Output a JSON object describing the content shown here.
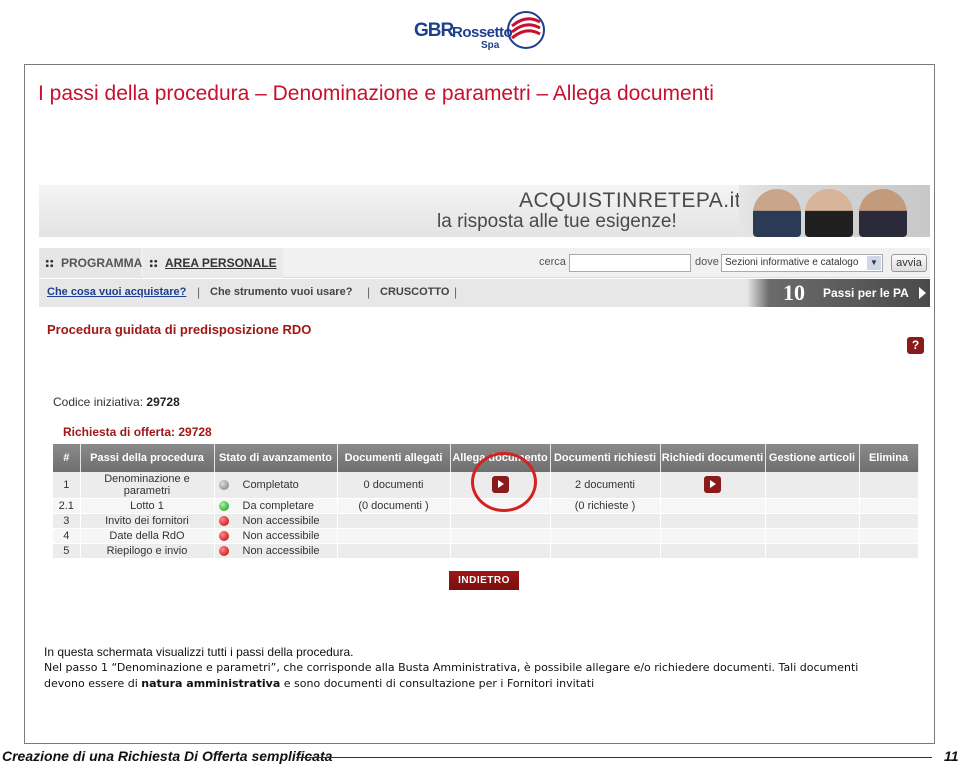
{
  "logo": {
    "gbr": "GBR",
    "rossetto": "Rossetto",
    "spa": "Spa"
  },
  "slide": {
    "title": "I passi della procedura – Denominazione e parametri – Allega documenti"
  },
  "banner": {
    "title": "ACQUISTINRETEPA.it",
    "subtitle": "la risposta alle tue esigenze!"
  },
  "nav": {
    "programma": "PROGRAMMA",
    "area_personale": "AREA PERSONALE",
    "cerca_label": "cerca",
    "cerca_value": "",
    "dove_label": "dove",
    "dove_value": "Sezioni informative e catalogo",
    "avvia": "avvia"
  },
  "subnav": {
    "item1": "Che cosa vuoi acquistare?",
    "sep": "|",
    "item2": "Che strumento vuoi usare?",
    "item3": "CRUSCOTTO",
    "passi_number": "10",
    "passi_label": "Passi per le PA"
  },
  "procedure": {
    "title": "Procedura guidata di predisposizione RDO",
    "help": "?",
    "codice_label": "Codice iniziativa:",
    "codice_value": "29728",
    "richiesta": "Richiesta di offerta: 29728"
  },
  "table": {
    "headers": [
      "#",
      "Passi della procedura",
      "Stato di avanzamento",
      "Documenti allegati",
      "Allega documento",
      "Documenti richiesti",
      "Richiedi documenti",
      "Gestione articoli",
      "Elimina"
    ],
    "rows": [
      {
        "num": "1",
        "passo": "Denominazione e parametri",
        "status_color": "grey",
        "stato": "Completato",
        "allegati": "0 documenti",
        "allega_icon": true,
        "richiesti": "2 documenti",
        "richiedi_icon": true
      },
      {
        "num": "2.1",
        "passo": "Lotto 1",
        "status_color": "green",
        "stato": "Da completare",
        "allegati": "(0 documenti )",
        "allega_icon": false,
        "richiesti": "(0 richieste )",
        "richiedi_icon": false
      },
      {
        "num": "3",
        "passo": "Invito dei fornitori",
        "status_color": "red",
        "stato": "Non accessibile",
        "allegati": "",
        "allega_icon": false,
        "richiesti": "",
        "richiedi_icon": false
      },
      {
        "num": "4",
        "passo": "Date della RdO",
        "status_color": "red",
        "stato": "Non accessibile",
        "allegati": "",
        "allega_icon": false,
        "richiesti": "",
        "richiedi_icon": false
      },
      {
        "num": "5",
        "passo": "Riepilogo e invio",
        "status_color": "red",
        "stato": "Non accessibile",
        "allegati": "",
        "allega_icon": false,
        "richiesti": "",
        "richiedi_icon": false
      }
    ],
    "indietro": "INDIETRO"
  },
  "description": {
    "line1": "In questa schermata visualizzi tutti i passi della procedura.",
    "line2": "Nel passo 1 “Denominazione e parametri”, che corrisponde alla Busta Amministrativa, è possibile allegare e/o richiedere documenti. Tali documenti",
    "line3_pre": "devono essere di ",
    "line3_bold": "natura amministrativa",
    "line3_post": " e sono documenti di consultazione per i Fornitori invitati"
  },
  "footer": {
    "title": "Creazione di una Richiesta Di Offerta semplificata",
    "page": "11"
  },
  "colors": {
    "title_red": "#c8102e",
    "dark_red": "#8b1a1a",
    "brand_blue": "#1d3f8f"
  }
}
